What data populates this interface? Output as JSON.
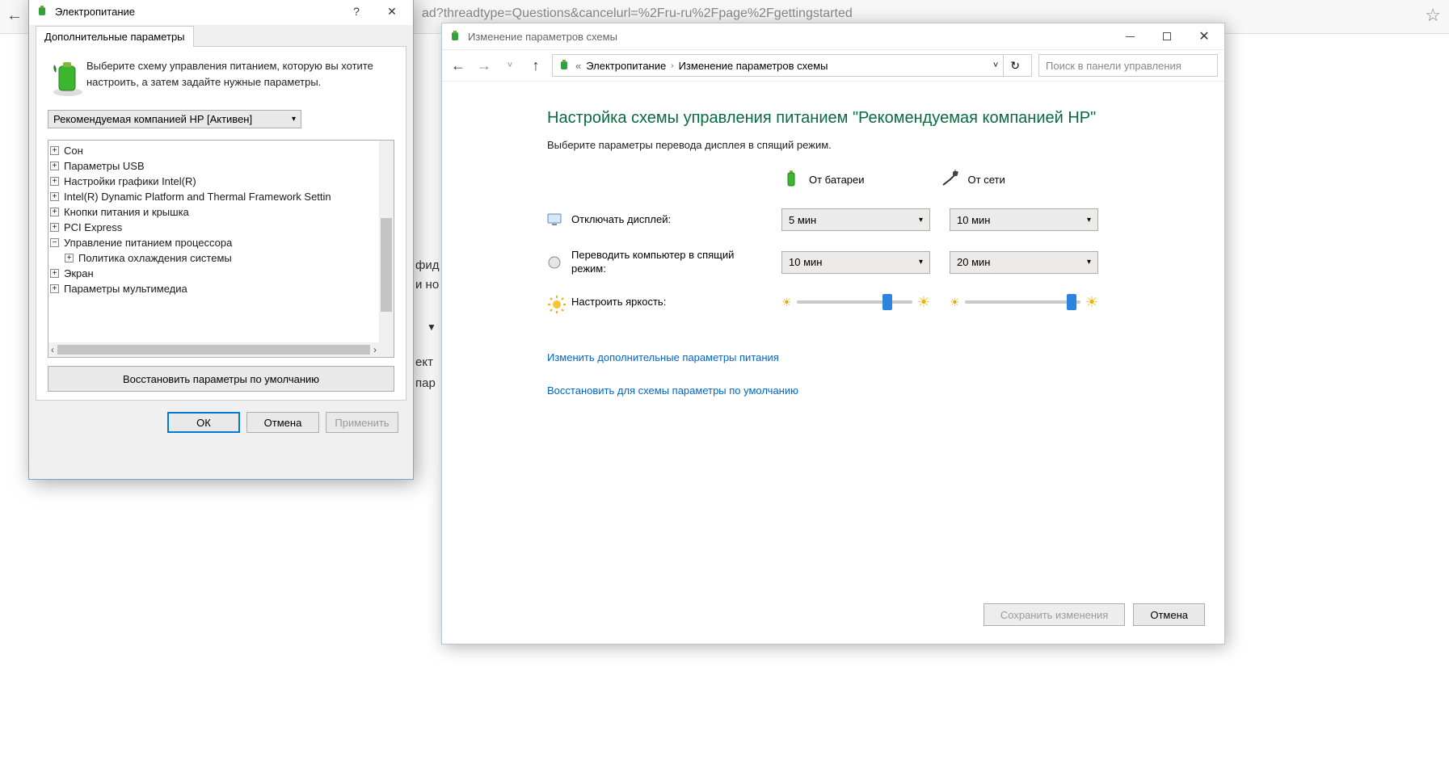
{
  "browser": {
    "url_fragment": "ad?threadtype=Questions&cancelurl=%2Fru-ru%2Fpage%2Fgettingstarted"
  },
  "dialog": {
    "title": "Электропитание",
    "tab": "Дополнительные параметры",
    "instruction": "Выберите схему управления питанием, которую вы хотите настроить, а затем задайте нужные параметры.",
    "scheme": "Рекомендуемая компанией HP [Активен]",
    "tree": [
      {
        "label": "Сон",
        "exp": "+"
      },
      {
        "label": "Параметры USB",
        "exp": "+"
      },
      {
        "label": "Настройки графики Intel(R)",
        "exp": "+"
      },
      {
        "label": "Intel(R) Dynamic Platform and Thermal Framework Settin",
        "exp": "+"
      },
      {
        "label": "Кнопки питания и крышка",
        "exp": "+"
      },
      {
        "label": "PCI Express",
        "exp": "+"
      },
      {
        "label": "Управление питанием процессора",
        "exp": "−"
      },
      {
        "label": "Политика охлаждения системы",
        "exp": "+",
        "indent": 1
      },
      {
        "label": "Экран",
        "exp": "+"
      },
      {
        "label": "Параметры мультимедиа",
        "exp": "+"
      }
    ],
    "restore_defaults": "Восстановить параметры по умолчанию",
    "ok": "ОК",
    "cancel": "Отмена",
    "apply": "Применить"
  },
  "explorer": {
    "title": "Изменение параметров схемы",
    "breadcrumb": {
      "lvl1": "Электропитание",
      "lvl2": "Изменение параметров схемы"
    },
    "search_placeholder": "Поиск в панели управления",
    "page_title": "Настройка схемы управления питанием \"Рекомендуемая компанией HP\"",
    "page_subtitle": "Выберите параметры перевода дисплея в спящий режим.",
    "col_battery": "От батареи",
    "col_mains": "От сети",
    "rows": {
      "display_off": {
        "label": "Отключать дисплей:",
        "battery": "5 мин",
        "mains": "10 мин"
      },
      "sleep": {
        "label": "Переводить компьютер в спящий режим:",
        "battery": "10 мин",
        "mains": "20 мин"
      },
      "brightness": {
        "label": "Настроить яркость:"
      }
    },
    "link_advanced": "Изменить дополнительные параметры питания",
    "link_restore": "Восстановить для схемы параметры по умолчанию",
    "save": "Сохранить изменения",
    "cancel": "Отмена"
  },
  "bg": {
    "t1": "фид",
    "t2": "и но",
    "t3": "ект",
    "t4": "пар"
  }
}
